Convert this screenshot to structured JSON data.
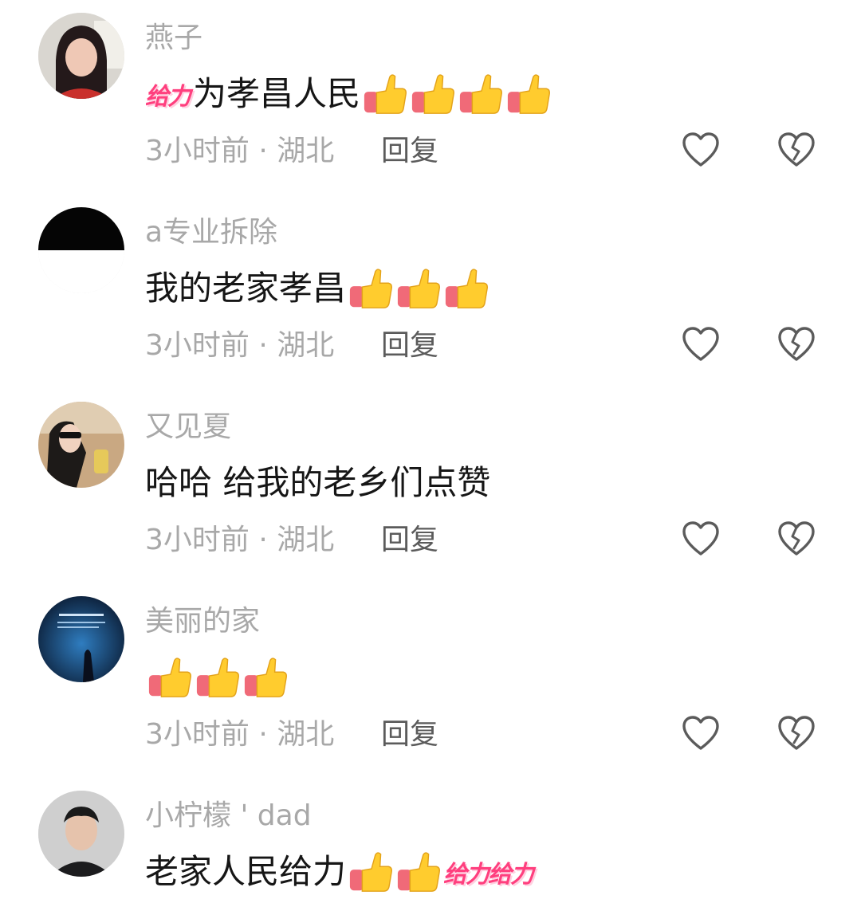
{
  "comments": [
    {
      "username": "燕子",
      "sticker_before": "给力",
      "text": "为孝昌人民",
      "thumbs": 4,
      "sticker_after": "",
      "time": "3小时前",
      "location": "湖北",
      "reply_label": "回复"
    },
    {
      "username": "a专业拆除",
      "sticker_before": "",
      "text": "我的老家孝昌",
      "thumbs": 3,
      "sticker_after": "",
      "time": "3小时前",
      "location": "湖北",
      "reply_label": "回复"
    },
    {
      "username": "又见夏",
      "sticker_before": "",
      "text": "哈哈 给我的老乡们点赞",
      "thumbs": 0,
      "sticker_after": "",
      "time": "3小时前",
      "location": "湖北",
      "reply_label": "回复"
    },
    {
      "username": "美丽的家",
      "sticker_before": "",
      "text": "",
      "thumbs": 3,
      "sticker_after": "",
      "time": "3小时前",
      "location": "湖北",
      "reply_label": "回复"
    },
    {
      "username": "小柠檬 ' dad",
      "sticker_before": "",
      "text": "老家人民给力",
      "thumbs": 2,
      "sticker_after": "给力给力",
      "time": "",
      "location": "",
      "reply_label": ""
    }
  ],
  "icons": {
    "like": "heart-outline-icon",
    "dislike": "broken-heart-icon",
    "emoji": "thumbs-up-emoji"
  },
  "colors": {
    "username": "#a8a8a8",
    "text": "#161616",
    "reply": "#5b5b5b",
    "sticker": "#ff3f7e",
    "thumb": "#ffcc2e",
    "cuff": "#f06a78"
  }
}
